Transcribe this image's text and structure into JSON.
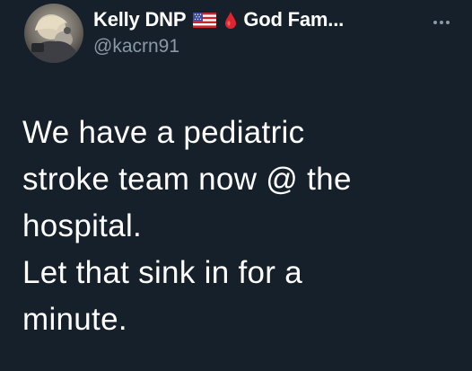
{
  "author": {
    "display_name": "Kelly DNP",
    "display_name_suffix": "God Fam...",
    "handle": "@kacrn91",
    "flag_icon": "us-flag-icon",
    "drop_icon": "blood-drop-icon",
    "drop_color": "#e0242e"
  },
  "menu": {
    "icon": "more-options-icon"
  },
  "tweet": {
    "lines": [
      "We have a pediatric",
      "stroke team now @ the",
      "hospital.",
      "Let that sink in for a",
      "minute."
    ]
  },
  "colors": {
    "background": "#15202b",
    "text": "#ffffff",
    "secondary_text": "#8b98a5"
  }
}
